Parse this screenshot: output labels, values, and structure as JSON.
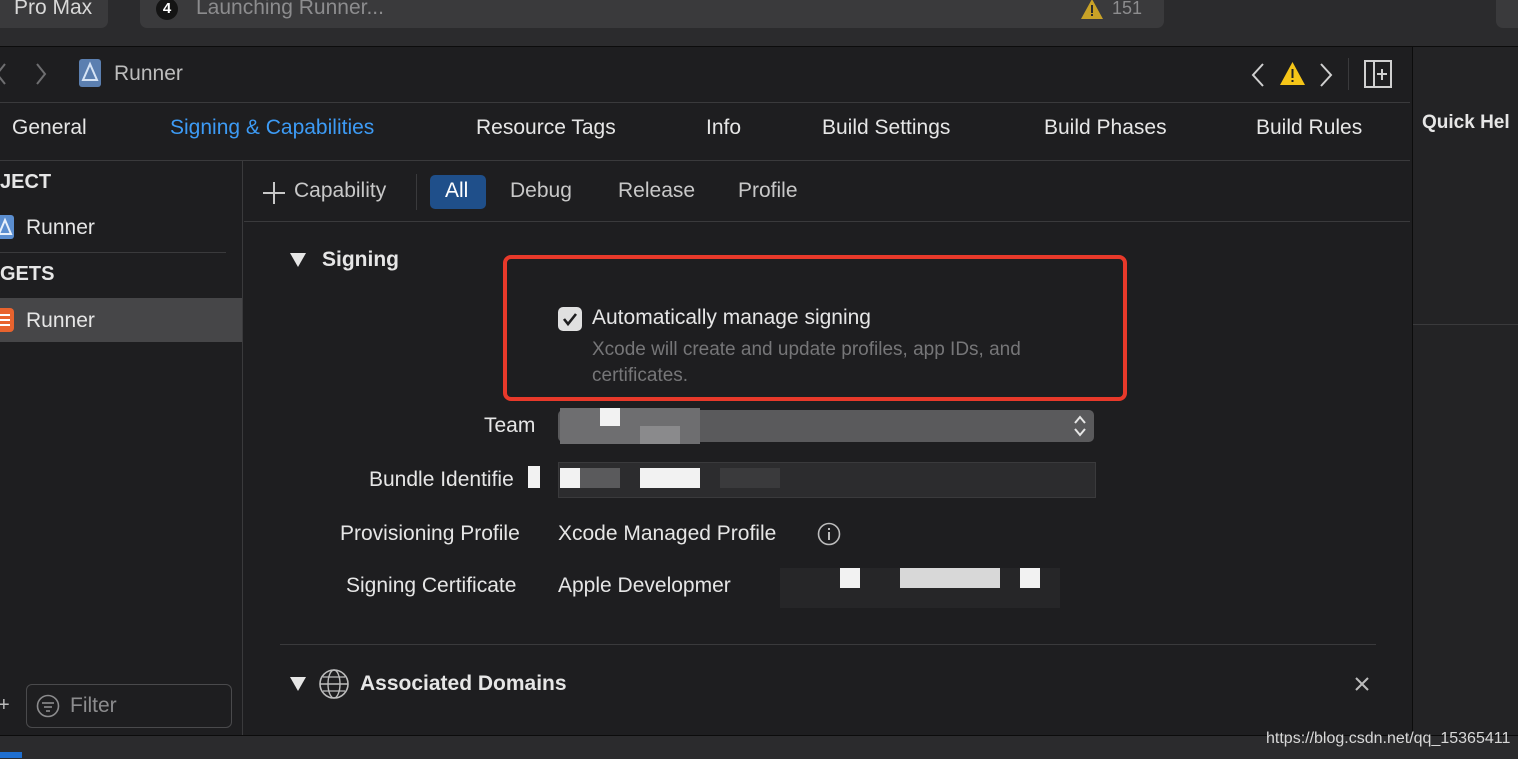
{
  "toolbar": {
    "device": "Pro Max",
    "activity_badge": "4",
    "activity_text": "Launching Runner...",
    "warning_count": "151"
  },
  "jumpbar": {
    "file": "Runner"
  },
  "tabs": [
    {
      "label": "General"
    },
    {
      "label": "Signing & Capabilities",
      "active": true
    },
    {
      "label": "Resource Tags"
    },
    {
      "label": "Info"
    },
    {
      "label": "Build Settings"
    },
    {
      "label": "Build Phases"
    },
    {
      "label": "Build Rules"
    }
  ],
  "inspector": {
    "title": "Quick Hel"
  },
  "navigator": {
    "project_header": "JECT",
    "project_item": "Runner",
    "targets_header": "GETS",
    "target_item": "Runner",
    "filter_placeholder": "Filter"
  },
  "capbar": {
    "add_capability": "Capability",
    "filters": [
      "All",
      "Debug",
      "Release",
      "Profile"
    ],
    "selected": "All"
  },
  "signing": {
    "title": "Signing",
    "auto_manage_label": "Automatically manage signing",
    "auto_manage_checked": true,
    "auto_manage_desc": "Xcode will create and update profiles, app IDs, and certificates.",
    "team_label": "Team",
    "bundle_label": "Bundle Identifie",
    "profile_label": "Provisioning Profile",
    "profile_value": "Xcode Managed Profile",
    "cert_label": "Signing Certificate",
    "cert_value": "Apple Developmer"
  },
  "associated_domains": {
    "title": "Associated Domains"
  },
  "colors": {
    "accent": "#3d9bf5",
    "highlight": "#e8392a",
    "warning": "#f5c518"
  },
  "watermark": "https://blog.csdn.net/qq_15365411"
}
